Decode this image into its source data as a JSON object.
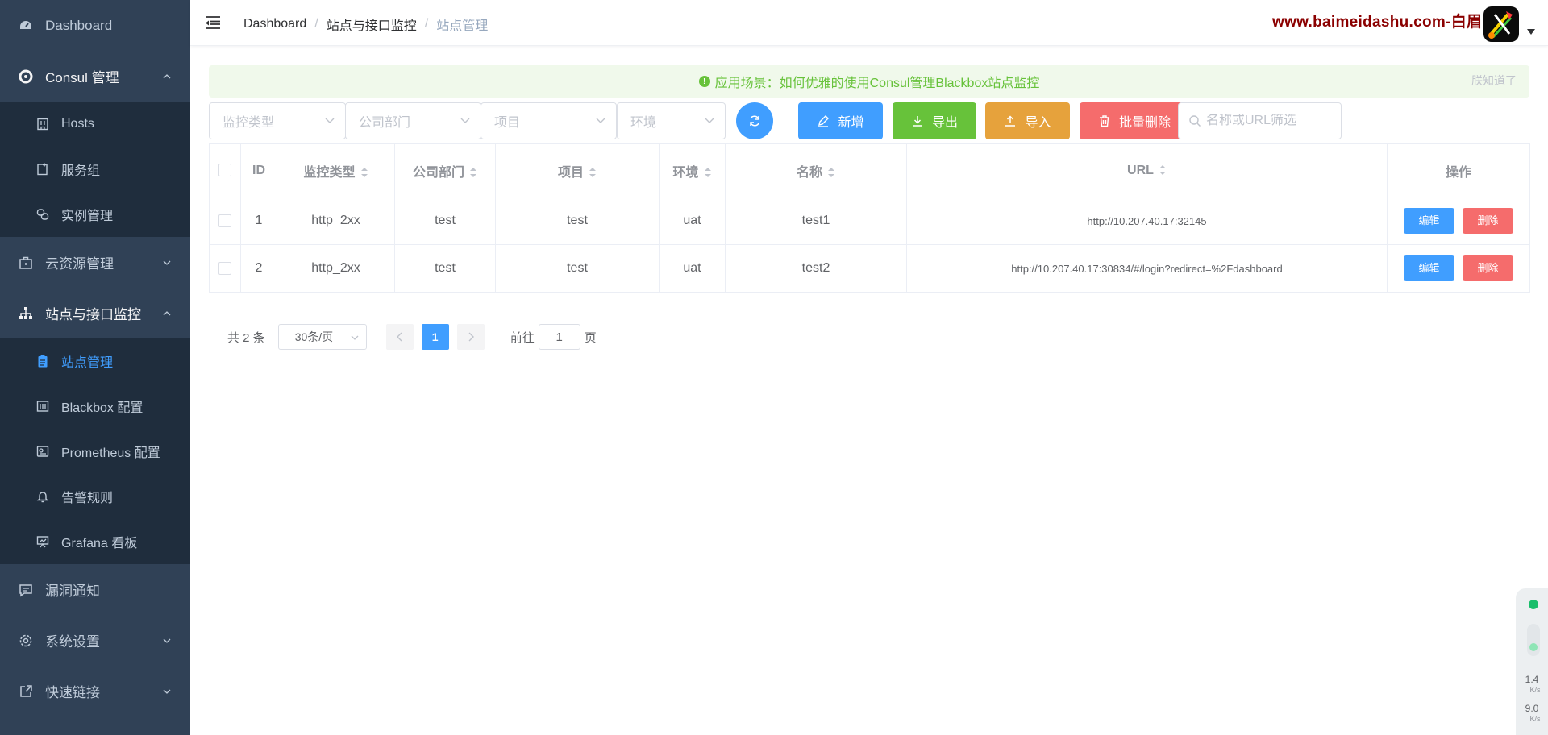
{
  "sidebar": {
    "dashboard": "Dashboard",
    "consul": "Consul 管理",
    "consul_items": [
      "Hosts",
      "服务组",
      "实例管理"
    ],
    "cloud": "云资源管理",
    "site": "站点与接口监控",
    "site_items": [
      "站点管理",
      "Blackbox 配置",
      "Prometheus 配置",
      "告警规则",
      "Grafana 看板"
    ],
    "vuln": "漏洞通知",
    "settings": "系统设置",
    "links": "快速链接"
  },
  "header": {
    "breadcrumb": [
      "Dashboard",
      "站点与接口监控",
      "站点管理"
    ],
    "sep": "/",
    "watermark": "www.baimeidashu.com-白眉大叔"
  },
  "alert": {
    "text": "应用场景：如何优雅的使用Consul管理Blackbox站点监控",
    "dismiss": "朕知道了"
  },
  "toolbar": {
    "filters": [
      "监控类型",
      "公司部门",
      "项目",
      "环境"
    ],
    "add": "新增",
    "export": "导出",
    "import": "导入",
    "batch_delete": "批量删除",
    "search_placeholder": "名称或URL筛选"
  },
  "table": {
    "headers": [
      "ID",
      "监控类型",
      "公司部门",
      "项目",
      "环境",
      "名称",
      "URL",
      "操作"
    ],
    "rows": [
      {
        "id": "1",
        "type": "http_2xx",
        "dept": "test",
        "project": "test",
        "env": "uat",
        "name": "test1",
        "url": "http://10.207.40.17:32145"
      },
      {
        "id": "2",
        "type": "http_2xx",
        "dept": "test",
        "project": "test",
        "env": "uat",
        "name": "test2",
        "url": "http://10.207.40.17:30834/#/login?redirect=%2Fdashboard"
      }
    ],
    "edit": "编辑",
    "delete": "删除"
  },
  "pagination": {
    "total": "共 2 条",
    "page_size": "30条/页",
    "current": "1",
    "goto": "前往",
    "goto_value": "1",
    "page_unit": "页"
  },
  "network": {
    "up": "1.4",
    "down": "9.0",
    "unit": "K/s"
  },
  "colors": {
    "primary": "#409eff",
    "success": "#67c23a",
    "warning": "#e6a23c",
    "danger": "#f56c6c",
    "sidebar": "#304156"
  }
}
